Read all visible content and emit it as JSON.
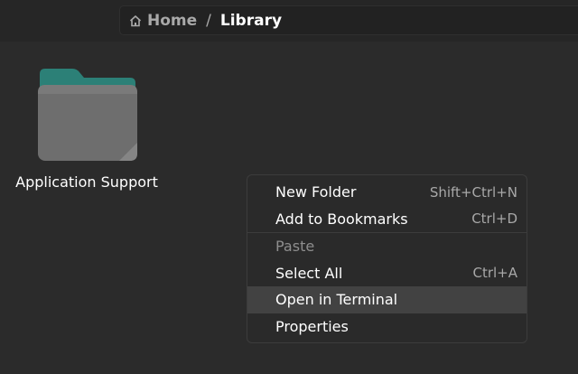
{
  "breadcrumb": {
    "items": [
      {
        "label": "Home",
        "icon": "home-icon"
      },
      {
        "label": "Library"
      }
    ],
    "separator": "/"
  },
  "files": [
    {
      "name": "Application Support",
      "type": "folder",
      "icon": "folder-icon"
    }
  ],
  "context_menu": {
    "items": [
      {
        "label": "New Folder",
        "shortcut": "Shift+Ctrl+N",
        "enabled": true
      },
      {
        "label": "Add to Bookmarks",
        "shortcut": "Ctrl+D",
        "enabled": true
      },
      {
        "label": "Paste",
        "shortcut": "",
        "enabled": false
      },
      {
        "label": "Select All",
        "shortcut": "Ctrl+A",
        "enabled": true
      },
      {
        "label": "Open in Terminal",
        "shortcut": "",
        "enabled": true,
        "highlighted": true
      },
      {
        "label": "Properties",
        "shortcut": "",
        "enabled": true
      }
    ]
  },
  "colors": {
    "background": "#2b2b2b",
    "folder_tab": "#2c8077",
    "folder_body": "#6e6e6e",
    "menu_highlight": "#424242"
  }
}
